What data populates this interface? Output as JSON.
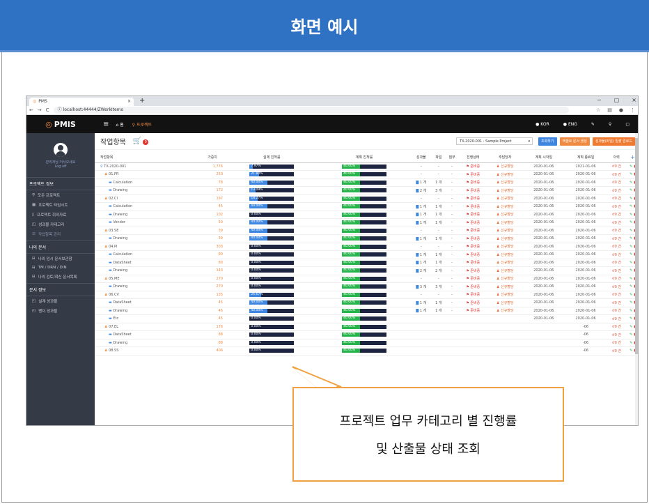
{
  "slide": {
    "title": "화면 예시"
  },
  "browser": {
    "tab_title": "PMS",
    "tab_close": "×",
    "new_tab": "+",
    "url": "localhost:44444/ZWorkItems",
    "win_min": "−",
    "win_max": "▢",
    "win_close": "×"
  },
  "appnav": {
    "logo": "PMIS",
    "home": "홈",
    "project": "프로젝트",
    "lang_kor": "KOR",
    "lang_eng": "ENG"
  },
  "sidebar": {
    "user_name": "관리자님 어서오세요",
    "logoff": "Log off",
    "section_project": "프로젝트 정보",
    "project_items": [
      "모든 프로젝트",
      "프로젝트 타임시트",
      "프로젝트 회의자료",
      "성과물 카테고리",
      "작업항목 관리"
    ],
    "section_docs": "나의 문서",
    "doc_items": [
      "나의 임시 문서보관함",
      "TM / DRN / DIN",
      "나의 검토/회신 문서목록"
    ],
    "section_docinfo": "문서 정보",
    "docinfo_items": [
      "설계 성과물",
      "벤더 성과물"
    ]
  },
  "page": {
    "title": "작업항목",
    "cart_count": "0",
    "project_select": "TX-2020-001 : Sample Project",
    "btn_search": "조회하기",
    "btn_excel": "엑셀로 문서 생성",
    "btn_upload": "성과물(파일) 일괄 업로드"
  },
  "table": {
    "headers": [
      "작업항목",
      "가중치",
      "실제 진척률",
      "계획 진척률",
      "성과물",
      "파일",
      "첨부",
      "진행상태",
      "주담당자",
      "계획 시작일",
      "계획 종료일",
      "이력",
      "+"
    ],
    "rows": [
      {
        "name": "TX-2020-001",
        "level": 0,
        "weight": "1,776",
        "actual": "7.97%",
        "actual_pct": 7.97,
        "plan": "40.00%",
        "plan_pct": 40,
        "deliverable": "-",
        "file": "-",
        "attach": "-",
        "status": "준비중",
        "manager": "신규할당",
        "start": "2020-01-06",
        "end": "2021-01-06",
        "history": "0 건"
      },
      {
        "name": "01.PR",
        "level": 1,
        "weight": "250",
        "actual": "21.80%",
        "actual_pct": 21.8,
        "plan": "40.00%",
        "plan_pct": 40,
        "deliverable": "-",
        "file": "-",
        "attach": "-",
        "status": "준비중",
        "manager": "신규할당",
        "start": "2020-01-06",
        "end": "2020-01-06",
        "history": "0 건"
      },
      {
        "name": "Calculation",
        "level": 2,
        "weight": "78",
        "actual": "40.00%",
        "actual_pct": 40,
        "plan": "40.00%",
        "plan_pct": 40,
        "deliverable": "1 개",
        "file": "1 개",
        "attach": "-",
        "status": "준비중",
        "manager": "신규할당",
        "start": "2020-01-06",
        "end": "2020-01-06",
        "history": "0 건"
      },
      {
        "name": "Drawing",
        "level": 2,
        "weight": "172",
        "actual": "13.09%",
        "actual_pct": 13.09,
        "plan": "40.00%",
        "plan_pct": 40,
        "deliverable": "2 개",
        "file": "3 개",
        "attach": "-",
        "status": "준비중",
        "manager": "신규할당",
        "start": "2020-01-06",
        "end": "2020-01-06",
        "history": "0 건"
      },
      {
        "name": "02.CI",
        "level": 1,
        "weight": "197",
        "actual": "18.27%",
        "actual_pct": 18.27,
        "plan": "40.00%",
        "plan_pct": 40,
        "deliverable": "-",
        "file": "-",
        "attach": "-",
        "status": "준비중",
        "manager": "신규할당",
        "start": "2020-01-06",
        "end": "2020-01-06",
        "history": "0 건"
      },
      {
        "name": "Calculation",
        "level": 2,
        "weight": "45",
        "actual": "40.00%",
        "actual_pct": 40,
        "plan": "40.00%",
        "plan_pct": 40,
        "deliverable": "1 개",
        "file": "1 개",
        "attach": "-",
        "status": "준비중",
        "manager": "신규할당",
        "start": "2020-01-06",
        "end": "2020-01-06",
        "history": "0 건"
      },
      {
        "name": "Drawing",
        "level": 2,
        "weight": "102",
        "actual": "0.00%",
        "actual_pct": 0,
        "plan": "40.00%",
        "plan_pct": 40,
        "deliverable": "1 개",
        "file": "1 개",
        "attach": "-",
        "status": "준비중",
        "manager": "신규할당",
        "start": "2020-01-06",
        "end": "2020-01-06",
        "history": "0 건"
      },
      {
        "name": "Vendor",
        "level": 2,
        "weight": "50",
        "actual": "40.00%",
        "actual_pct": 40,
        "plan": "40.00%",
        "plan_pct": 40,
        "deliverable": "1 개",
        "file": "1 개",
        "attach": "-",
        "status": "준비중",
        "manager": "신규할당",
        "start": "2020-01-06",
        "end": "2020-01-06",
        "history": "0 건"
      },
      {
        "name": "03.SE",
        "level": 1,
        "weight": "39",
        "actual": "40.00%",
        "actual_pct": 40,
        "plan": "40.00%",
        "plan_pct": 40,
        "deliverable": "-",
        "file": "-",
        "attach": "-",
        "status": "준비중",
        "manager": "신규할당",
        "start": "2020-01-06",
        "end": "2020-01-06",
        "history": "0 건"
      },
      {
        "name": "Drawing",
        "level": 2,
        "weight": "39",
        "actual": "40.00%",
        "actual_pct": 40,
        "plan": "40.00%",
        "plan_pct": 40,
        "deliverable": "1 개",
        "file": "1 개",
        "attach": "-",
        "status": "준비중",
        "manager": "신규할당",
        "start": "2020-01-06",
        "end": "2020-01-06",
        "history": "0 건"
      },
      {
        "name": "04.PI",
        "level": 1,
        "weight": "303",
        "actual": "0.00%",
        "actual_pct": 0,
        "plan": "40.00%",
        "plan_pct": 40,
        "deliverable": "-",
        "file": "-",
        "attach": "-",
        "status": "준비중",
        "manager": "신규할당",
        "start": "2020-01-06",
        "end": "2020-01-06",
        "history": "0 건"
      },
      {
        "name": "Calculation",
        "level": 2,
        "weight": "80",
        "actual": "0.00%",
        "actual_pct": 0,
        "plan": "40.00%",
        "plan_pct": 40,
        "deliverable": "1 개",
        "file": "1 개",
        "attach": "-",
        "status": "준비중",
        "manager": "신규할당",
        "start": "2020-01-06",
        "end": "2020-01-06",
        "history": "0 건"
      },
      {
        "name": "DataSheet",
        "level": 2,
        "weight": "80",
        "actual": "0.00%",
        "actual_pct": 0,
        "plan": "40.00%",
        "plan_pct": 40,
        "deliverable": "1 개",
        "file": "1 개",
        "attach": "-",
        "status": "준비중",
        "manager": "신규할당",
        "start": "2020-01-06",
        "end": "2020-01-06",
        "history": "0 건"
      },
      {
        "name": "Drawing",
        "level": 2,
        "weight": "143",
        "actual": "0.00%",
        "actual_pct": 0,
        "plan": "40.00%",
        "plan_pct": 40,
        "deliverable": "2 개",
        "file": "2 개",
        "attach": "-",
        "status": "준비중",
        "manager": "신규할당",
        "start": "2020-01-06",
        "end": "2020-01-06",
        "history": "0 건"
      },
      {
        "name": "05.ME",
        "level": 1,
        "weight": "270",
        "actual": "0.00%",
        "actual_pct": 0,
        "plan": "40.00%",
        "plan_pct": 40,
        "deliverable": "-",
        "file": "-",
        "attach": "-",
        "status": "준비중",
        "manager": "신규할당",
        "start": "2020-01-06",
        "end": "2020-01-06",
        "history": "0 건"
      },
      {
        "name": "Drawing",
        "level": 2,
        "weight": "270",
        "actual": "0.00%",
        "actual_pct": 0,
        "plan": "40.00%",
        "plan_pct": 40,
        "deliverable": "3 개",
        "file": "3 개",
        "attach": "-",
        "status": "준비중",
        "manager": "신규할당",
        "start": "2020-01-06",
        "end": "2020-01-06",
        "history": "0 건"
      },
      {
        "name": "06.CV",
        "level": 1,
        "weight": "135",
        "actual": "26.67%",
        "actual_pct": 26.67,
        "plan": "40.00%",
        "plan_pct": 40,
        "deliverable": "-",
        "file": "-",
        "attach": "-",
        "status": "준비중",
        "manager": "신규할당",
        "start": "2020-01-06",
        "end": "2020-01-06",
        "history": "0 건"
      },
      {
        "name": "DataSheet",
        "level": 2,
        "weight": "45",
        "actual": "40.00%",
        "actual_pct": 40,
        "plan": "40.00%",
        "plan_pct": 40,
        "deliverable": "1 개",
        "file": "1 개",
        "attach": "-",
        "status": "준비중",
        "manager": "신규할당",
        "start": "2020-01-06",
        "end": "2020-01-06",
        "history": "0 건"
      },
      {
        "name": "Drawing",
        "level": 2,
        "weight": "45",
        "actual": "40.00%",
        "actual_pct": 40,
        "plan": "40.00%",
        "plan_pct": 40,
        "deliverable": "1 개",
        "file": "1 개",
        "attach": "-",
        "status": "준비중",
        "manager": "신규할당",
        "start": "2020-01-06",
        "end": "2020-01-06",
        "history": "0 건"
      },
      {
        "name": "Etc",
        "level": 2,
        "weight": "45",
        "actual": "0.00%",
        "actual_pct": 0,
        "plan": "40.00%",
        "plan_pct": 40,
        "deliverable": "",
        "file": "",
        "attach": "",
        "status": "",
        "manager": "",
        "start": "2020-01-06",
        "end": "2020-01-06",
        "history": "0 건"
      },
      {
        "name": "07.EL",
        "level": 1,
        "weight": "176",
        "actual": "0.00%",
        "actual_pct": 0,
        "plan": "40.00%",
        "plan_pct": 40,
        "deliverable": "",
        "file": "",
        "attach": "",
        "status": "",
        "manager": "",
        "start": "",
        "end": "-06",
        "history": "0 건"
      },
      {
        "name": "DataSheet",
        "level": 2,
        "weight": "88",
        "actual": "0.00%",
        "actual_pct": 0,
        "plan": "40.00%",
        "plan_pct": 40,
        "deliverable": "",
        "file": "",
        "attach": "",
        "status": "",
        "manager": "",
        "start": "",
        "end": "-06",
        "history": "0 건"
      },
      {
        "name": "Drawing",
        "level": 2,
        "weight": "88",
        "actual": "0.00%",
        "actual_pct": 0,
        "plan": "40.00%",
        "plan_pct": 40,
        "deliverable": "",
        "file": "",
        "attach": "",
        "status": "",
        "manager": "",
        "start": "",
        "end": "-06",
        "history": "0 건"
      },
      {
        "name": "08.SS",
        "level": 1,
        "weight": "406",
        "actual": "0.00%",
        "actual_pct": 0,
        "plan": "40.00%",
        "plan_pct": 40,
        "deliverable": "",
        "file": "",
        "attach": "",
        "status": "",
        "manager": "",
        "start": "",
        "end": "-06",
        "history": "0 건"
      }
    ]
  },
  "callout": {
    "line1": "프로젝트 업무 카테고리 별 진행률",
    "line2": "및 산출물 상태 조회"
  },
  "colors": {
    "slide_header": "#2f72c4",
    "accent_orange": "#f08a40",
    "bar_blue": "#3f86e0",
    "bar_green": "#27b44a"
  }
}
